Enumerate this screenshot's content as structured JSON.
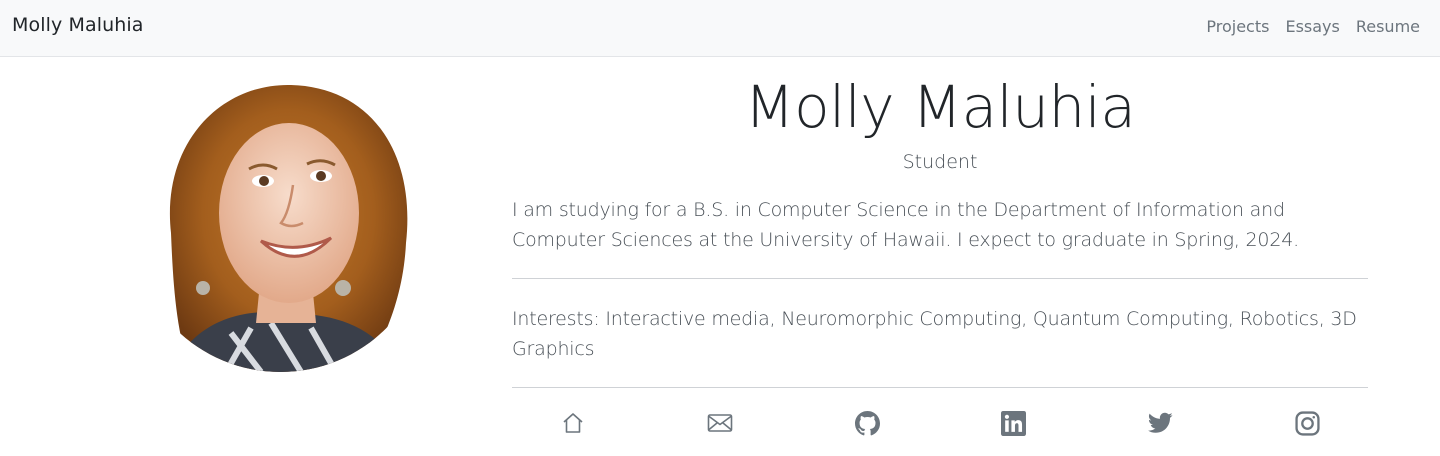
{
  "nav": {
    "brand": "Molly Maluhia",
    "links": [
      "Projects",
      "Essays",
      "Resume"
    ]
  },
  "profile": {
    "name": "Molly Maluhia",
    "role": "Student",
    "about": "I am studying for a B.S. in Computer Science in the Department of Information and Computer Sciences at the University of Hawaii. I expect to graduate in Spring, 2024.",
    "interests": "Interests: Interactive media, Neuromorphic Computing, Quantum Computing, Robotics, 3D Graphics"
  },
  "social_icons": [
    "home-icon",
    "envelope-icon",
    "github-icon",
    "linkedin-icon",
    "twitter-icon",
    "instagram-icon"
  ],
  "colors": {
    "navbar_bg": "#f8f9fa",
    "text_dark": "#212529",
    "text_muted": "#6c757d",
    "icon_color": "#6c757d"
  }
}
